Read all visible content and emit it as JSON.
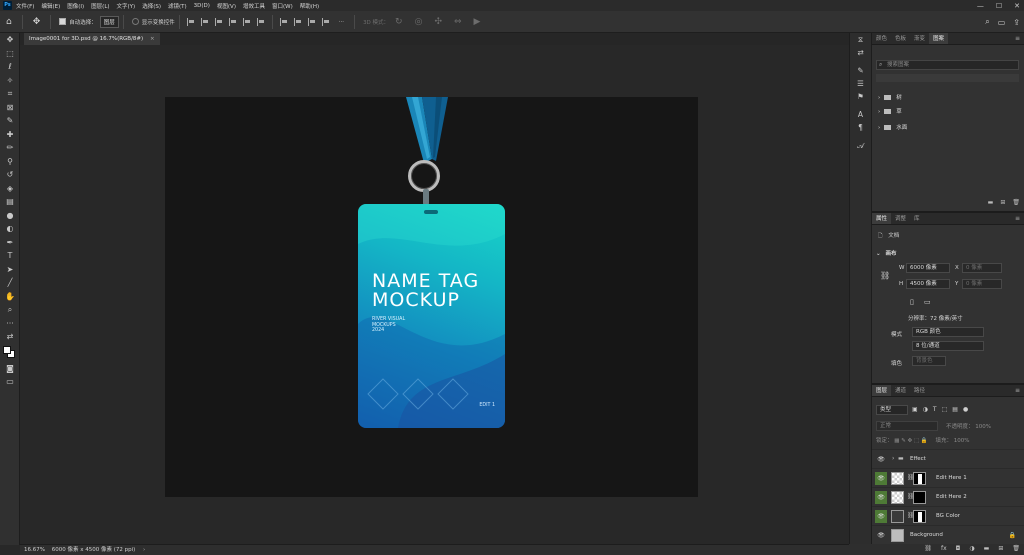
{
  "app": {
    "logo": "Ps"
  },
  "menu": [
    "文件(F)",
    "编辑(E)",
    "图像(I)",
    "图层(L)",
    "文字(Y)",
    "选择(S)",
    "滤镜(T)",
    "3D(D)",
    "视图(V)",
    "增效工具",
    "窗口(W)",
    "帮助(H)"
  ],
  "window_controls": {
    "minimize": "—",
    "maximize": "☐",
    "close": "✕"
  },
  "options": {
    "auto_select_label": "自动选择：",
    "auto_select_target": "图层",
    "show_transform_label": "显示变换控件",
    "mode_label": "3D 模式：",
    "more": "···"
  },
  "document": {
    "tab_title": "Image0001 for 3D.psd @ 16.7%(RGB/8#)",
    "tab_close": "×",
    "zoom": "16.67%",
    "size_info": "6000 像素 x 4500 像素 (72 ppi)"
  },
  "mockup": {
    "title_line1": "NAME TAG",
    "title_line2": "MOCKUP",
    "subtitle": [
      "RIVER VISUAL",
      "MOCKUPS",
      "2024"
    ],
    "edit_label": "EDIT 1"
  },
  "libraries_panel": {
    "tabs": [
      "颜色",
      "色板",
      "渐变",
      "图案"
    ],
    "active_tab": 3,
    "search_placeholder": "搜索图案",
    "groups": [
      "树",
      "草",
      "水面"
    ]
  },
  "properties_panel": {
    "tabs": [
      "属性",
      "调整",
      "库"
    ],
    "doc_label": "文档",
    "section": "画布",
    "width_label": "W",
    "width_value": "6000 像素",
    "x_label": "X",
    "x_placeholder": "0 像素",
    "height_label": "H",
    "height_value": "4500 像素",
    "y_label": "Y",
    "y_placeholder": "0 像素",
    "resolution": "分辨率：72 像素/英寸",
    "mode_label": "模式",
    "mode_value": "RGB 颜色",
    "depth_value": "8 位/通道",
    "fill_label": "填色",
    "fill_value": "背景色"
  },
  "layers_panel": {
    "tabs": [
      "图层",
      "通道",
      "路径"
    ],
    "filter_label": "类型",
    "blend_mode": "正常",
    "opacity_label": "不透明度：",
    "opacity_value": "100%",
    "lock_label": "锁定：",
    "fill_label": "填充：",
    "fill_value": "100%",
    "layers": [
      {
        "name": "Effect",
        "type": "group",
        "visible": true,
        "highlight": false
      },
      {
        "name": "Edit Here 1",
        "type": "smart",
        "visible": true,
        "highlight": true
      },
      {
        "name": "Edit Here 2",
        "type": "smart",
        "visible": true,
        "highlight": true
      },
      {
        "name": "BG Color",
        "type": "fill",
        "visible": true,
        "highlight": true
      },
      {
        "name": "Background",
        "type": "background",
        "visible": true,
        "highlight": false
      }
    ]
  },
  "colors": {
    "accent_green": "#4e7a36",
    "card_top": "#18d6c8",
    "card_bottom": "#1562b0",
    "artboard": "#161616"
  }
}
